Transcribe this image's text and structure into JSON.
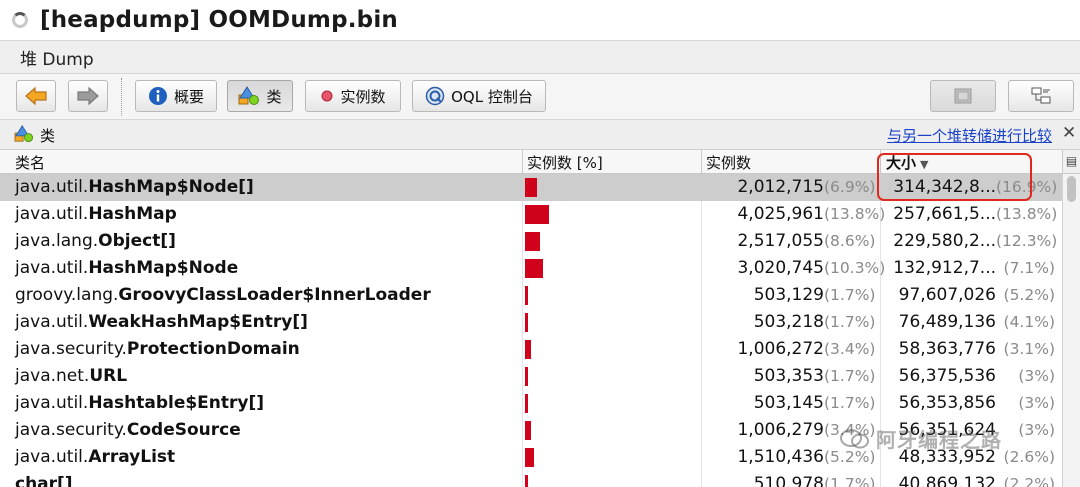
{
  "window": {
    "title": "[heapdump] OOMDump.bin"
  },
  "tab": {
    "label": "堆 Dump"
  },
  "toolbar": {
    "overview_label": "概要",
    "classes_label": "类",
    "instances_label": "实例数",
    "oql_label": "OQL 控制台"
  },
  "panel": {
    "title": "类",
    "compare_link": "与另一个堆转储进行比较"
  },
  "table": {
    "columns": {
      "name": "类名",
      "instances_pct": "实例数 [%]",
      "instances": "实例数",
      "size": "大小"
    },
    "rows": [
      {
        "pkg": "java.util.",
        "cls": "HashMap$Node[]",
        "count": "2,012,715",
        "count_pct": "(6.9%)",
        "bar_pct": 6.9,
        "size": "314,342,8...",
        "size_pct": "(16.9%)"
      },
      {
        "pkg": "java.util.",
        "cls": "HashMap",
        "count": "4,025,961",
        "count_pct": "(13.8%)",
        "bar_pct": 13.8,
        "size": "257,661,5...",
        "size_pct": "(13.8%)"
      },
      {
        "pkg": "java.lang.",
        "cls": "Object[]",
        "count": "2,517,055",
        "count_pct": "(8.6%)",
        "bar_pct": 8.6,
        "size": "229,580,2...",
        "size_pct": "(12.3%)"
      },
      {
        "pkg": "java.util.",
        "cls": "HashMap$Node",
        "count": "3,020,745",
        "count_pct": "(10.3%)",
        "bar_pct": 10.3,
        "size": "132,912,7...",
        "size_pct": "(7.1%)"
      },
      {
        "pkg": "groovy.lang.",
        "cls": "GroovyClassLoader$InnerLoader",
        "count": "503,129",
        "count_pct": "(1.7%)",
        "bar_pct": 1.7,
        "size": "97,607,026",
        "size_pct": "(5.2%)"
      },
      {
        "pkg": "java.util.",
        "cls": "WeakHashMap$Entry[]",
        "count": "503,218",
        "count_pct": "(1.7%)",
        "bar_pct": 1.7,
        "size": "76,489,136",
        "size_pct": "(4.1%)"
      },
      {
        "pkg": "java.security.",
        "cls": "ProtectionDomain",
        "count": "1,006,272",
        "count_pct": "(3.4%)",
        "bar_pct": 3.4,
        "size": "58,363,776",
        "size_pct": "(3.1%)"
      },
      {
        "pkg": "java.net.",
        "cls": "URL",
        "count": "503,353",
        "count_pct": "(1.7%)",
        "bar_pct": 1.7,
        "size": "56,375,536",
        "size_pct": "(3%)"
      },
      {
        "pkg": "java.util.",
        "cls": "Hashtable$Entry[]",
        "count": "503,145",
        "count_pct": "(1.7%)",
        "bar_pct": 1.7,
        "size": "56,353,856",
        "size_pct": "(3%)"
      },
      {
        "pkg": "java.security.",
        "cls": "CodeSource",
        "count": "1,006,279",
        "count_pct": "(3.4%)",
        "bar_pct": 3.4,
        "size": "56,351,624",
        "size_pct": "(3%)"
      },
      {
        "pkg": "java.util.",
        "cls": "ArrayList",
        "count": "1,510,436",
        "count_pct": "(5.2%)",
        "bar_pct": 5.2,
        "size": "48,333,952",
        "size_pct": "(2.6%)"
      },
      {
        "pkg": "",
        "cls": "char[]",
        "count": "510,978",
        "count_pct": "(1.7%)",
        "bar_pct": 1.7,
        "size": "40,869,132",
        "size_pct": "(2.2%)"
      }
    ],
    "selected_row": 0
  },
  "watermark": {
    "text": "阿牙编程之路"
  },
  "colors": {
    "bar": "#d0021b",
    "highlight": "#e0281c",
    "link": "#1b43c8"
  }
}
